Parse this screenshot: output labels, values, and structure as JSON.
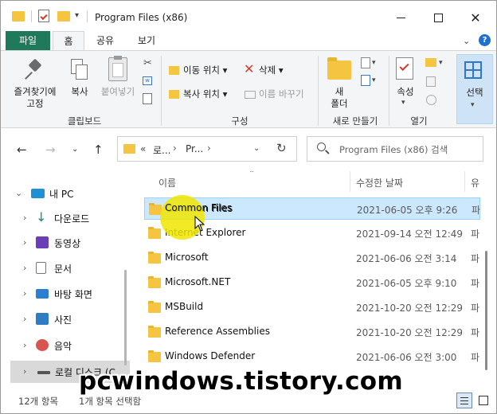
{
  "window": {
    "title": "Program Files (x86)"
  },
  "ribbon_tabs": [
    {
      "label": "파일"
    },
    {
      "label": "홈"
    },
    {
      "label": "공유"
    },
    {
      "label": "보기"
    }
  ],
  "ribbon": {
    "pin_label_1": "즐겨찾기에",
    "pin_label_2": "고정",
    "copy_label": "복사",
    "paste_label": "붙여넣기",
    "move_to_label": "이동 위치",
    "copy_to_label": "복사 위치",
    "delete_label": "삭제",
    "rename_label": "이름 바꾸기",
    "new_folder_label_1": "새",
    "new_folder_label_2": "폴더",
    "properties_label": "속성",
    "select_label": "선택",
    "group_clipboard": "클립보드",
    "group_organize": "구성",
    "group_new": "새로 만들기",
    "group_open": "열기"
  },
  "navigation": {
    "breadcrumb_overflow": "«",
    "breadcrumb_1": "로...",
    "breadcrumb_2": "Pr...",
    "search_placeholder": "Program Files (x86) 검색"
  },
  "tree": [
    {
      "label": "내 PC",
      "icon": "pc-icon",
      "color": "#1e90d6"
    },
    {
      "label": "다운로드",
      "icon": "download-icon",
      "color": "#1a8f6a"
    },
    {
      "label": "동영상",
      "icon": "video-icon",
      "color": "#6a3fb5"
    },
    {
      "label": "문서",
      "icon": "document-icon",
      "color": "#6b7a8a"
    },
    {
      "label": "바탕 화면",
      "icon": "desktop-icon",
      "color": "#2b7fd0"
    },
    {
      "label": "사진",
      "icon": "picture-icon",
      "color": "#2d7cc4"
    },
    {
      "label": "음악",
      "icon": "music-icon",
      "color": "#d9534f"
    },
    {
      "label": "로컬 디스크 (C",
      "icon": "drive-icon",
      "color": "#555555"
    }
  ],
  "columns": {
    "name": "이름",
    "date_modified": "수정한 날짜",
    "type": "유"
  },
  "files": [
    {
      "name": "Common Files",
      "date": "2021-06-05 오후 9:26",
      "type": "파"
    },
    {
      "name": "Internet Explorer",
      "date": "2021-09-14 오전 12:49",
      "type": "파"
    },
    {
      "name": "Microsoft",
      "date": "2021-06-06 오전 3:14",
      "type": "파"
    },
    {
      "name": "Microsoft.NET",
      "date": "2021-06-05 오후 9:10",
      "type": "파"
    },
    {
      "name": "MSBuild",
      "date": "2021-10-20 오전 12:29",
      "type": "파"
    },
    {
      "name": "Reference Assemblies",
      "date": "2021-10-20 오전 12:29",
      "type": "파"
    },
    {
      "name": "Windows Defender",
      "date": "2021-06-06 오전 3:00",
      "type": "파"
    }
  ],
  "status": {
    "item_count": "12개 항목",
    "selected": "1개 항목 선택함"
  },
  "watermark": "pcwindows.tistory.com",
  "colors": {
    "file_tab": "#1f7a5c",
    "selection": "#cce8ff",
    "folder": "#f5c542",
    "highlight": "#f0e600"
  }
}
